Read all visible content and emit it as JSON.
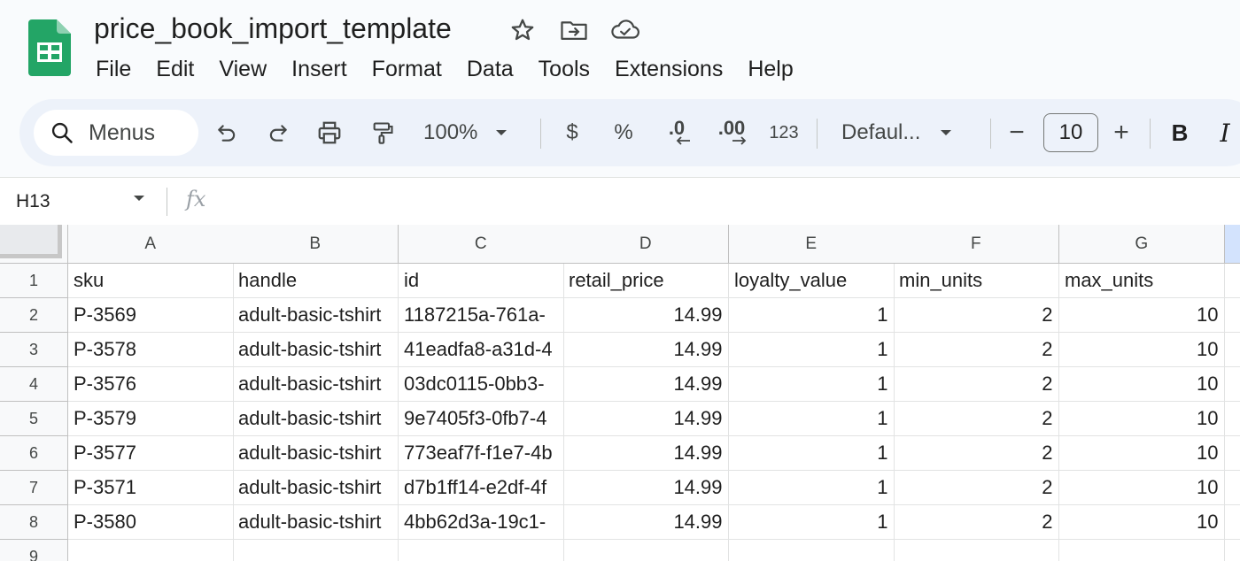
{
  "app": {
    "title": "price_book_import_template"
  },
  "menu": [
    "File",
    "Edit",
    "View",
    "Insert",
    "Format",
    "Data",
    "Tools",
    "Extensions",
    "Help"
  ],
  "toolbar": {
    "search_label": "Menus",
    "zoom": "100%",
    "currency": "$",
    "percent": "%",
    "decrease_decimal": ".0",
    "increase_decimal": ".00",
    "number_format": "123",
    "font_name": "Defaul...",
    "font_size": "10",
    "bold": "B",
    "italic": "I",
    "minus": "−",
    "plus": "+"
  },
  "formula_bar": {
    "cell_ref": "H13",
    "fx": "fx"
  },
  "sheet": {
    "columns": [
      "A",
      "B",
      "C",
      "D",
      "E",
      "F",
      "G"
    ],
    "row_numbers": [
      "1",
      "2",
      "3",
      "4",
      "5",
      "6",
      "7",
      "8",
      "9"
    ],
    "header": [
      "sku",
      "handle",
      "id",
      "retail_price",
      "loyalty_value",
      "min_units",
      "max_units"
    ],
    "rows": [
      [
        "P-3569",
        "adult-basic-tshirt",
        "1187215a-761a-",
        "14.99",
        "1",
        "2",
        "10"
      ],
      [
        "P-3578",
        "adult-basic-tshirt",
        "41eadfa8-a31d-4",
        "14.99",
        "1",
        "2",
        "10"
      ],
      [
        "P-3576",
        "adult-basic-tshirt",
        "03dc0115-0bb3-",
        "14.99",
        "1",
        "2",
        "10"
      ],
      [
        "P-3579",
        "adult-basic-tshirt",
        "9e7405f3-0fb7-4",
        "14.99",
        "1",
        "2",
        "10"
      ],
      [
        "P-3577",
        "adult-basic-tshirt",
        "773eaf7f-f1e7-4b",
        "14.99",
        "1",
        "2",
        "10"
      ],
      [
        "P-3571",
        "adult-basic-tshirt",
        "d7b1ff14-e2df-4f",
        "14.99",
        "1",
        "2",
        "10"
      ],
      [
        "P-3580",
        "adult-basic-tshirt",
        "4bb62d3a-19c1-",
        "14.99",
        "1",
        "2",
        "10"
      ]
    ]
  },
  "colors": {
    "sheets_green": "#0f9d58",
    "toolbar_bg": "#edf2fa",
    "selected_col": "#d3e3fd"
  }
}
